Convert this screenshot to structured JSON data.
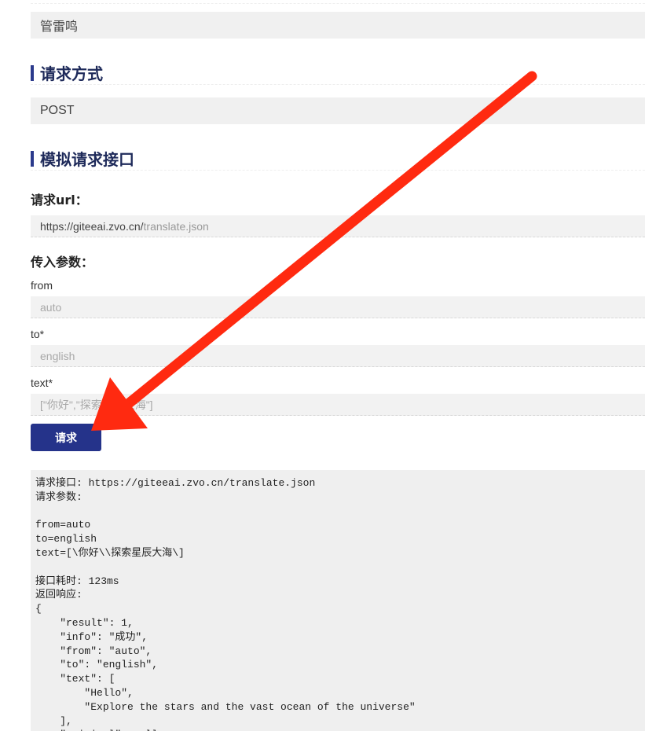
{
  "author": {
    "name": "管雷鸣"
  },
  "request_method": {
    "title": "请求方式",
    "value": "POST"
  },
  "mock_request": {
    "title": "模拟请求接口",
    "url_label": "请求url：",
    "url_base": "https://giteeai.zvo.cn/",
    "url_path": "translate.json",
    "params_label": "传入参数：",
    "params": [
      {
        "label": "from",
        "placeholder": "auto"
      },
      {
        "label": "to*",
        "placeholder": "english"
      },
      {
        "label": "text*",
        "placeholder": "[\"你好\",\"探索星辰大海\"]"
      }
    ],
    "button_label": "请求"
  },
  "response": {
    "text": "请求接口: https://giteeai.zvo.cn/translate.json\n请求参数:\n\nfrom=auto\nto=english\ntext=[\\你好\\\\探索星辰大海\\]\n\n接口耗时: 123ms\n返回响应:\n{\n    \"result\": 1,\n    \"info\": \"成功\",\n    \"from\": \"auto\",\n    \"to\": \"english\",\n    \"text\": [\n        \"Hello\",\n        \"Explore the stars and the vast ocean of the universe\"\n    ],\n    \"original\": null"
  },
  "annotation": {
    "arrow_color": "#ff2a10"
  }
}
